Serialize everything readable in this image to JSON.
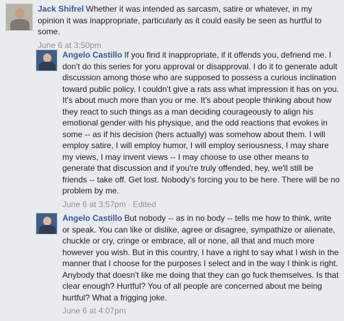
{
  "comments": [
    {
      "author": "Jack Shifrel",
      "text": "Whether it was intended as sarcasm, satire or whatever, in my opinion it was inappropriate, particularly as it could easily be seen as hurtful to some.",
      "time": "June 6 at 3:50pm",
      "edited": ""
    },
    {
      "author": "Angelo Castillo",
      "text": "If you find it inappropriate, if it offends you, defriend me. I don't do this series for yoru approval or disapproval. I do it to generate adult discussion among those who are supposed to possess a curious inclination toward public policy. I couldn't give a rats ass what impression it has on you. It's about much more than you or me. It's about people thinking about how they react to such things as a man deciding courageously to align his emotional gender with his physique, and the odd reactions that evokes in some -- as if his decision (hers actually) was somehow about them. I will employ satire, I will employ humor, I will employ seriousness, I may share my views, I may invent views -- I may choose to use other means to generate that discussion and if you're truly offended, hey, we'll still be friends -- take off. Get lost. Nobody's forcing you to be here. There will be no problem by me.",
      "time": "June 6 at 3:57pm",
      "edited": "Edited"
    },
    {
      "author": "Angelo Castillo",
      "text": "But nobody -- as in no body -- tells me how to think, write or speak. You can like or dislike, agree or disagree, sympathize or alienate, chuckle or cry, cringe or embrace, all or none, all that and much more however you wish. But in this country, I have a right to say what I wish in the manner that I choose for the purposes I select and in the way I think is right. Anybody that doesn't like me doing that they can go fuck themselves. Is that clear enough? Hurtful? You of all people are concerned about me being hurtful? What a frigging joke.",
      "time": "June 6 at 4:07pm",
      "edited": ""
    }
  ],
  "colors": {
    "author": "#365899",
    "meta": "#90949c",
    "background": "#e9ebee"
  },
  "icons": [
    "avatar-jack",
    "avatar-angelo"
  ]
}
